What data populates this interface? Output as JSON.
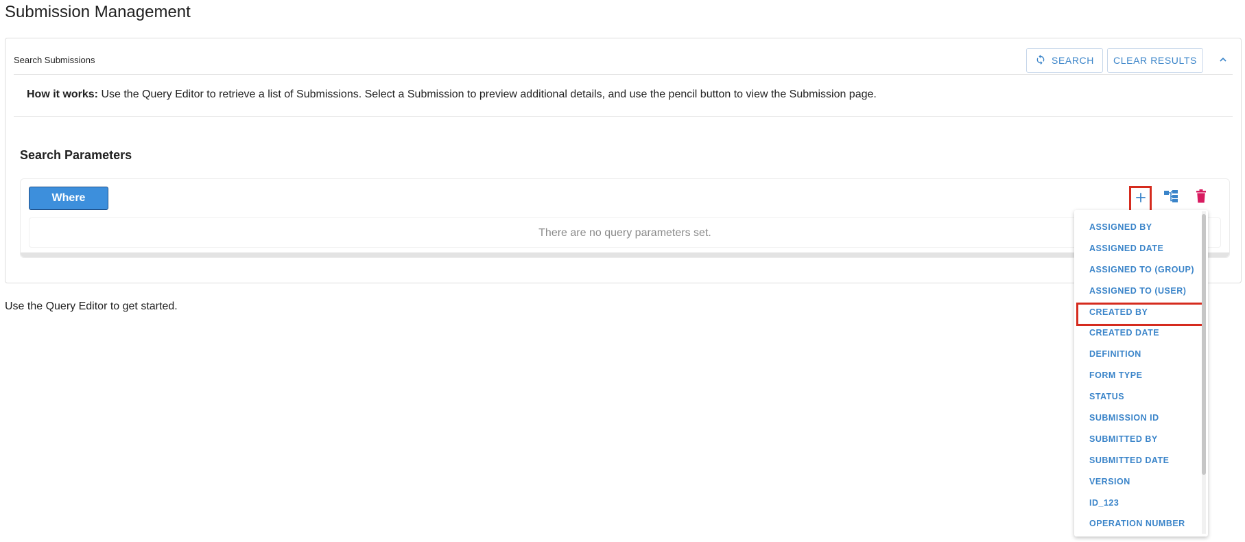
{
  "page": {
    "title": "Submission Management"
  },
  "panel": {
    "title": "Search Submissions",
    "search_label": "SEARCH",
    "clear_label": "CLEAR RESULTS",
    "how_it_works_label": "How it works:",
    "how_it_works_text": " Use the Query Editor to retrieve a list of Submissions. Select a Submission to preview additional details, and use the pencil button to view the Submission page."
  },
  "search_params": {
    "title": "Search Parameters",
    "where_label": "Where",
    "empty_text": "There are no query parameters set."
  },
  "footer": {
    "text": "Use the Query Editor to get started."
  },
  "dropdown": {
    "items": [
      "ASSIGNED BY",
      "ASSIGNED DATE",
      "ASSIGNED TO (GROUP)",
      "ASSIGNED TO (USER)",
      "CREATED BY",
      "CREATED DATE",
      "DEFINITION",
      "FORM TYPE",
      "STATUS",
      "SUBMISSION ID",
      "SUBMITTED BY",
      "SUBMITTED DATE",
      "VERSION",
      "ID_123",
      "OPERATION NUMBER"
    ],
    "highlighted": "CREATED BY"
  },
  "colors": {
    "accent": "#3a84c9",
    "where_button": "#3d8fdc",
    "delete": "#d81b60",
    "highlight_box": "#d52b1e"
  },
  "icons": {
    "search_button": "refresh-icon",
    "collapse": "chevron-up-icon",
    "add": "plus-icon",
    "group": "tree-icon",
    "delete": "trash-icon"
  }
}
